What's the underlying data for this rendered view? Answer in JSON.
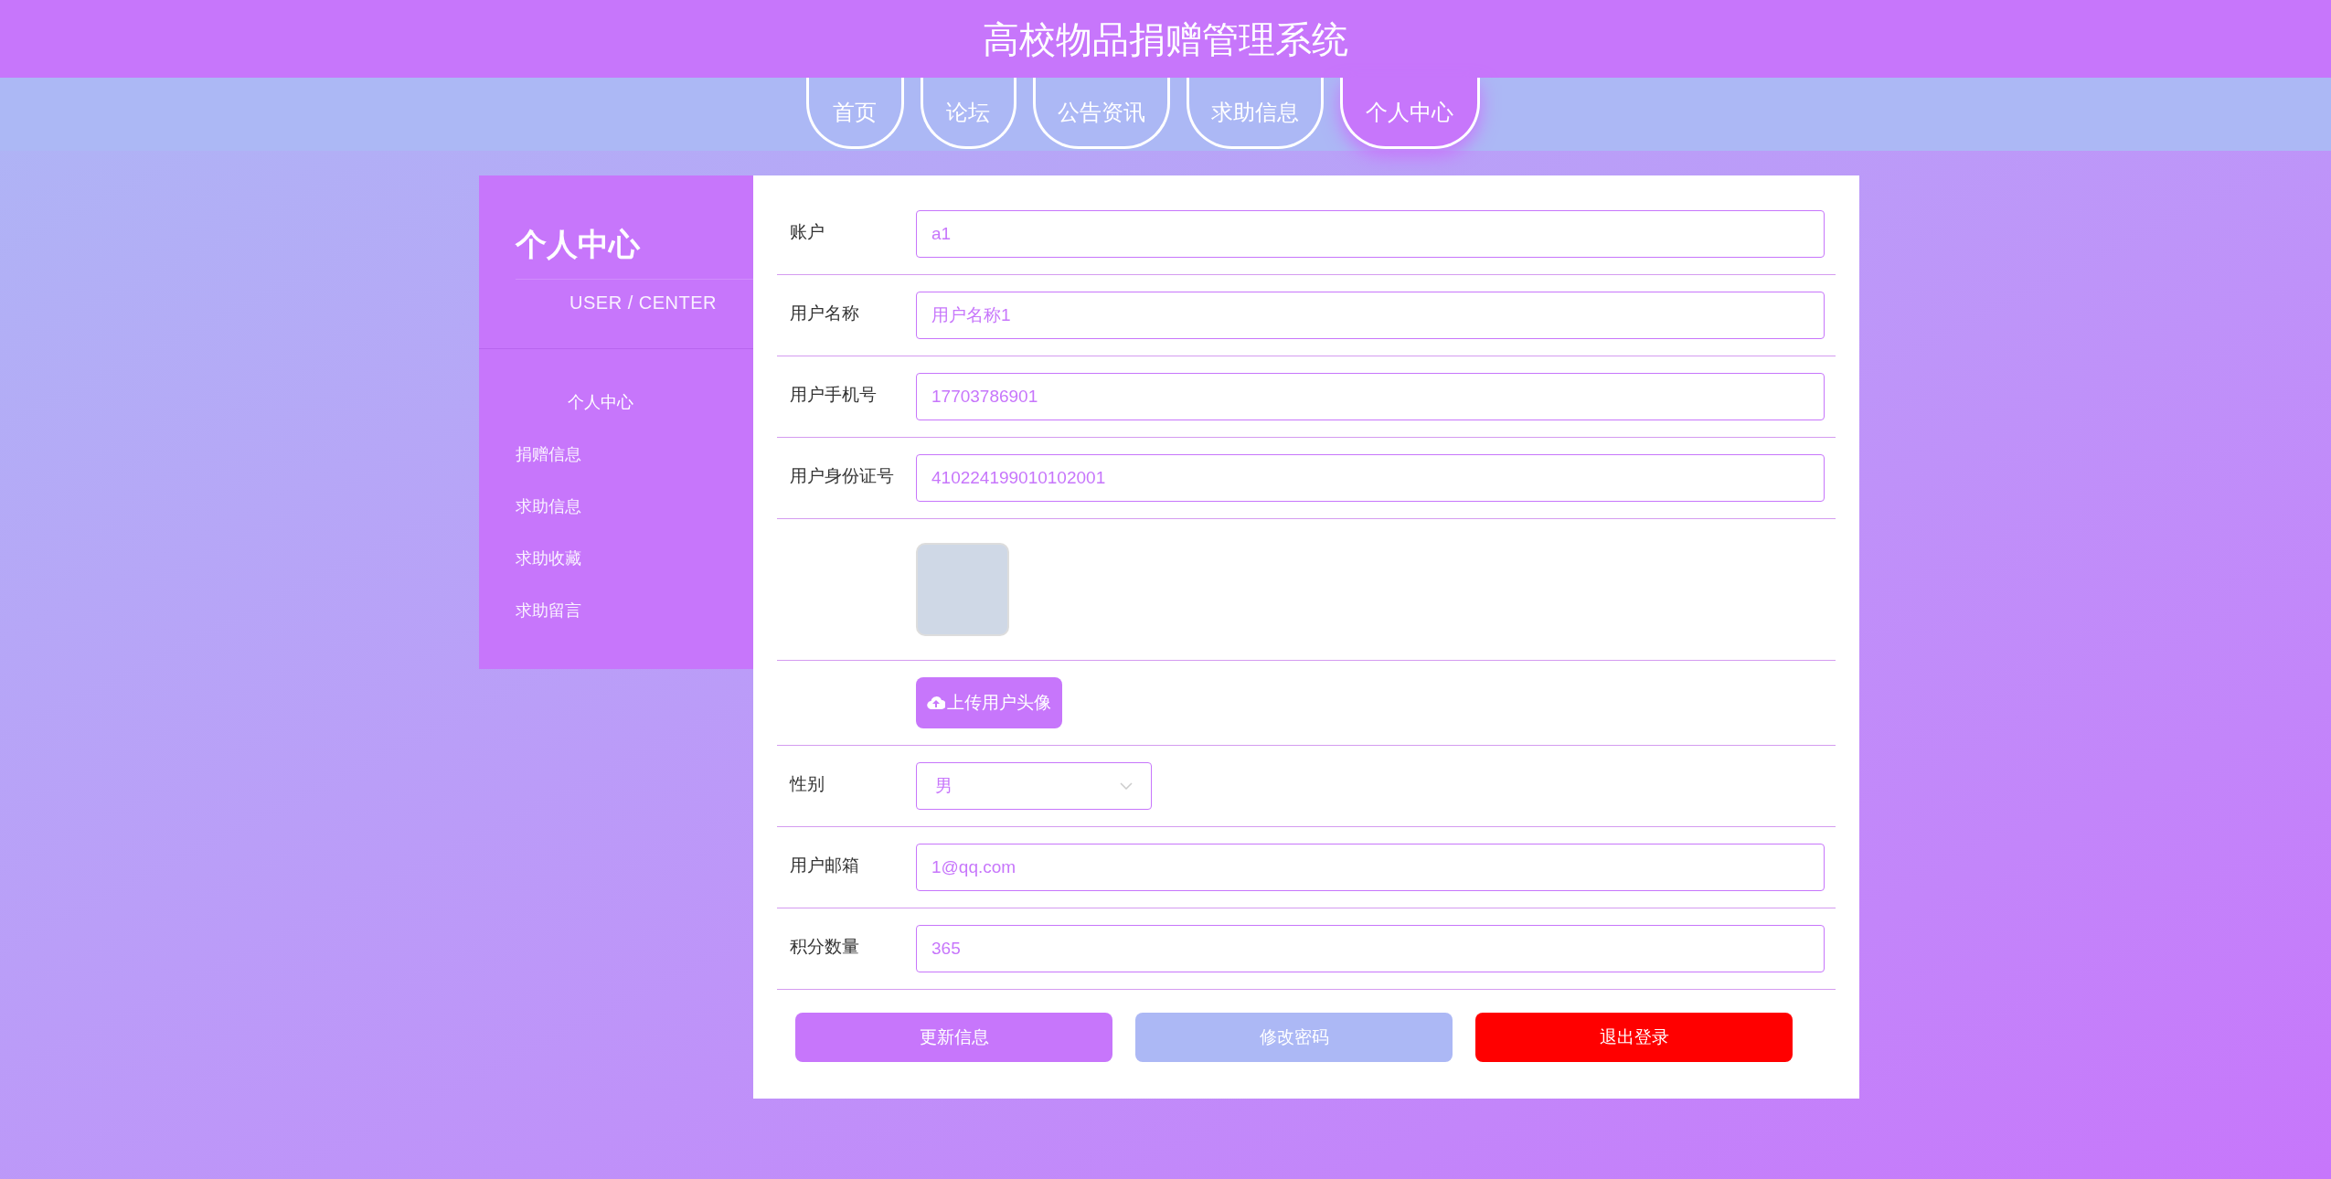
{
  "header": {
    "title": "高校物品捐赠管理系统"
  },
  "tabs": [
    {
      "label": "首页",
      "selected": false
    },
    {
      "label": "论坛",
      "selected": false
    },
    {
      "label": "公告资讯",
      "selected": false
    },
    {
      "label": "求助信息",
      "selected": false
    },
    {
      "label": "个人中心",
      "selected": true
    }
  ],
  "sidebar": {
    "title": "个人中心",
    "subtitle": "USER / CENTER",
    "items": [
      {
        "label": "个人中心",
        "selected": true
      },
      {
        "label": "捐赠信息",
        "selected": false
      },
      {
        "label": "求助信息",
        "selected": false
      },
      {
        "label": "求助收藏",
        "selected": false
      },
      {
        "label": "求助留言",
        "selected": false
      }
    ]
  },
  "form": {
    "fields": [
      {
        "kind": "text",
        "label": "账户",
        "value": "a1"
      },
      {
        "kind": "text",
        "label": "用户名称",
        "value": "用户名称1"
      },
      {
        "kind": "text",
        "label": "用户手机号",
        "value": "17703786901"
      },
      {
        "kind": "text",
        "label": "用户身份证号",
        "value": "410224199010102001"
      },
      {
        "kind": "avatar"
      },
      {
        "kind": "upload",
        "button": "上传用户头像"
      },
      {
        "kind": "select",
        "label": "性别",
        "value": "男"
      },
      {
        "kind": "text",
        "label": "用户邮箱",
        "value": "1@qq.com"
      },
      {
        "kind": "text",
        "label": "积分数量",
        "value": "365"
      }
    ],
    "buttons": [
      {
        "kind": "primary",
        "label": "更新信息"
      },
      {
        "kind": "secondary",
        "label": "修改密码"
      },
      {
        "kind": "danger",
        "label": "退出登录"
      }
    ]
  }
}
